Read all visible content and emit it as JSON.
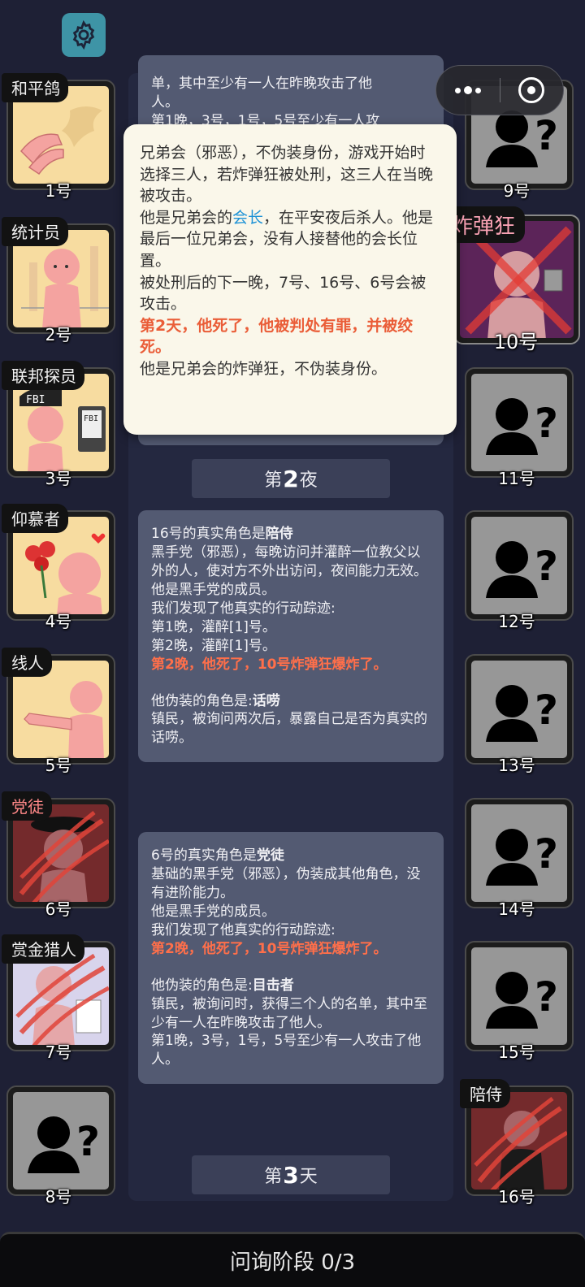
{
  "header": {
    "settings_icon": "gear-icon"
  },
  "capsule": {
    "more_icon": "more-dots-icon",
    "close_icon": "target-circle-icon"
  },
  "players_left": [
    {
      "number": "1号",
      "role": "和平鸽"
    },
    {
      "number": "2号",
      "role": "统计员"
    },
    {
      "number": "3号",
      "role": "联邦探员"
    },
    {
      "number": "4号",
      "role": "仰慕者"
    },
    {
      "number": "5号",
      "role": "线人"
    },
    {
      "number": "6号",
      "role": "党徒",
      "dead": true
    },
    {
      "number": "7号",
      "role": "赏金猎人",
      "dead": true
    },
    {
      "number": "8号",
      "role": ""
    }
  ],
  "players_right": [
    {
      "number": "9号",
      "role": ""
    },
    {
      "number": "10号",
      "role": "炸弹狂",
      "dead": true
    },
    {
      "number": "11号",
      "role": ""
    },
    {
      "number": "12号",
      "role": ""
    },
    {
      "number": "13号",
      "role": ""
    },
    {
      "number": "14号",
      "role": ""
    },
    {
      "number": "15号",
      "role": ""
    },
    {
      "number": "16号",
      "role": "陪侍",
      "dead": true
    }
  ],
  "partial_top": {
    "line1": "单，其中至少有一人在昨晚攻击了他",
    "line2": "人。",
    "line3": "第1晚，3号，1号，5号至少有一人攻"
  },
  "tooltip": {
    "p1": "兄弟会（邪恶），不伪装身份，游戏开始时选择三人，若炸弹狂被处刑，这三人在当晚被攻击。",
    "p2_a": "他是兄弟会的",
    "p2_link": "会长",
    "p2_b": "，在平安夜后杀人。他是最后一位兄弟会，没有人接替他的会长位置。",
    "p3": "被处刑后的下一晚，7号、16号、6号会被攻击。",
    "p4": "第2天，他死了，他被判处有罪，并被绞死。",
    "p5": "他是兄弟会的炸弹狂，不伪装身份。"
  },
  "phase_night2": {
    "prefix": "第",
    "num": "2",
    "suffix": "夜"
  },
  "card16": {
    "title_a": "16号的真实角色是",
    "title_b": "陪侍",
    "desc": "黑手党（邪恶），每晚访问并灌醉一位教父以外的人，使对方不外出访问，夜间能力无效。",
    "member": "他是黑手党的成员。",
    "trace": "我们发现了他真实的行动踪迹:",
    "n1": "第1晚，灌醉[1]号。",
    "n2": "第2晚，灌醉[1]号。",
    "death": "第2晚，他死了，10号炸弹狂爆炸了。",
    "fake_a": "他伪装的角色是:",
    "fake_b": "话唠",
    "fake_desc": "镇民，被询问两次后，暴露自己是否为真实的话唠。"
  },
  "card6": {
    "title_a": "6号的真实角色是",
    "title_b": "党徒",
    "desc": "基础的黑手党（邪恶），伪装成其他角色，没有进阶能力。",
    "member": "他是黑手党的成员。",
    "trace": "我们发现了他真实的行动踪迹:",
    "death": "第2晚，他死了，10号炸弹狂爆炸了。",
    "fake_a": "他伪装的角色是:",
    "fake_b": "目击者",
    "fake_desc": "镇民，被询问时，获得三个人的名单，其中至少有一人在昨晚攻击了他人。",
    "n1": "第1晚，3号，1号，5号至少有一人攻击了他人。"
  },
  "phase_day3": {
    "prefix": "第",
    "num": "3",
    "suffix": "天"
  },
  "bottom_bar": {
    "label": "问询阶段 0/3"
  },
  "colors": {
    "background": "#1e2035",
    "card": "#535a72",
    "highlight_red": "#ff6f4a",
    "link_blue": "#1e92d6"
  }
}
